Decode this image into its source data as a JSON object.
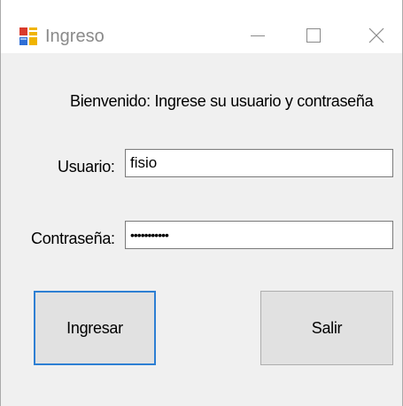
{
  "window": {
    "title": "Ingreso",
    "icon": "forms-app-icon",
    "controls": {
      "minimize_icon": "minimize-icon",
      "maximize_icon": "maximize-icon",
      "close_icon": "close-icon"
    }
  },
  "form": {
    "welcome": "Bienvenido: Ingrese su usuario y contraseña",
    "username": {
      "label": "Usuario:",
      "value": "fisio"
    },
    "password": {
      "label": "Contraseña:",
      "value": "•••••••••••"
    },
    "buttons": {
      "login": "Ingresar",
      "exit": "Salir"
    }
  },
  "colors": {
    "client_background": "#f0f0f0",
    "titlebar_background": "#ffffff",
    "title_text": "#8a8a8a",
    "button_face": "#e1e1e1",
    "focus_border": "#2d7fd3"
  }
}
